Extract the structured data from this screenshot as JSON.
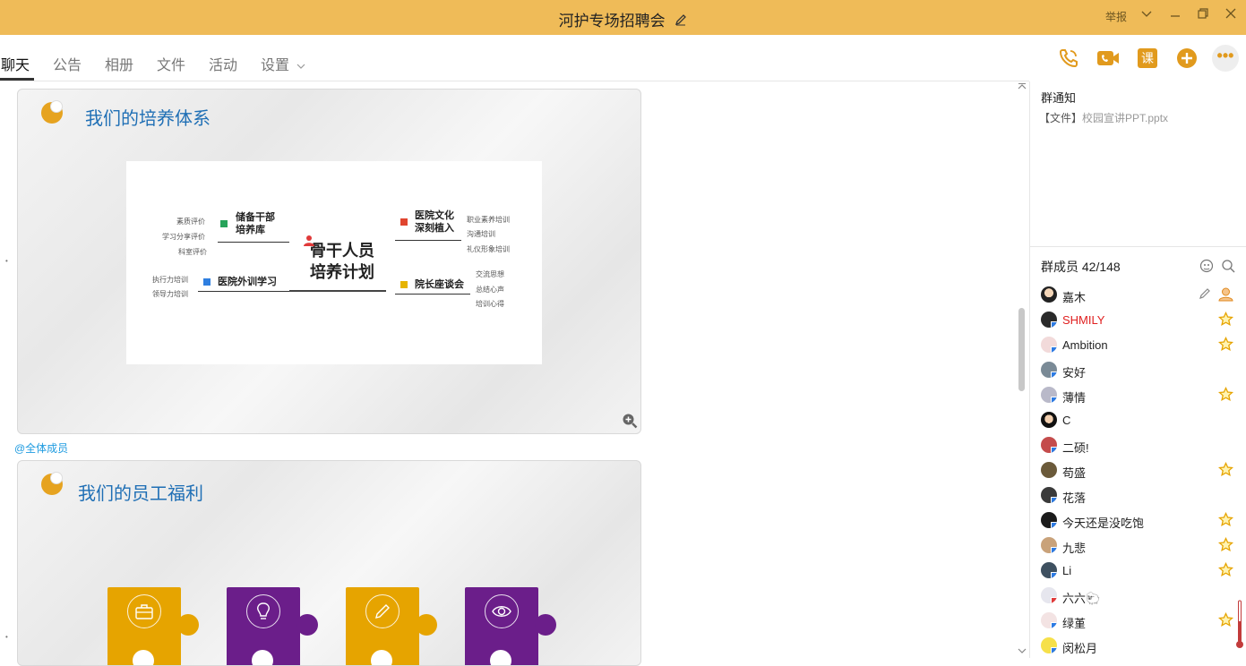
{
  "window": {
    "title": "河护专场招聘会",
    "report_label": "举报",
    "accent_color": "#efbb58"
  },
  "tabs": [
    {
      "label": "聊天",
      "active": true
    },
    {
      "label": "公告"
    },
    {
      "label": "相册"
    },
    {
      "label": "文件"
    },
    {
      "label": "活动"
    },
    {
      "label": "设置"
    }
  ],
  "toolbar": {
    "icons": [
      "phone-icon",
      "video-call-icon",
      "course-icon",
      "add-icon",
      "more-icon"
    ],
    "course_label": "课",
    "more_label": "•••"
  },
  "chat": {
    "slide1": {
      "title": "我们的培养体系",
      "mindmap": {
        "center": "骨干人员\n培养计划",
        "branches": [
          {
            "label": "储备干部\n培养库",
            "leaves": [
              "素质评价",
              "学习分享评价",
              "科室评价"
            ]
          },
          {
            "label": "医院外训学习",
            "leaves": [
              "执行力培训",
              "领导力培训"
            ]
          },
          {
            "label": "医院文化\n深刻植入",
            "leaves": [
              "职业素养培训",
              "沟通培训",
              "礼仪形象培训"
            ]
          },
          {
            "label": "院长座谈会",
            "leaves": [
              "交流思想",
              "总结心声",
              "培训心得"
            ]
          }
        ]
      }
    },
    "mention": "@全体成员",
    "slide2": {
      "title": "我们的员工福利",
      "puzzle_colors": [
        "#e6a400",
        "#6b1e8a",
        "#e6a400",
        "#6b1e8a"
      ],
      "puzzle_icons": [
        "briefcase-icon",
        "lightbulb-icon",
        "pencil-icon",
        "eye-icon"
      ]
    }
  },
  "notice": {
    "title": "群通知",
    "prefix": "【文件】",
    "file": "校园宣讲PPT.pptx"
  },
  "members": {
    "title": "群成员 42/148",
    "list": [
      {
        "name": "嘉木",
        "star": false,
        "owner": true
      },
      {
        "name": "SHMILY",
        "star": true,
        "red": true
      },
      {
        "name": "Ambition",
        "star": true
      },
      {
        "name": "安好",
        "star": false
      },
      {
        "name": "薄情",
        "star": true
      },
      {
        "name": "C",
        "star": false
      },
      {
        "name": "二硕!",
        "star": false
      },
      {
        "name": "苟盛",
        "star": true
      },
      {
        "name": "花落",
        "star": false
      },
      {
        "name": "今天还是没吃饱",
        "star": true
      },
      {
        "name": "九悲",
        "star": true
      },
      {
        "name": "Li",
        "star": true
      },
      {
        "name": "六六🐑",
        "star": false
      },
      {
        "name": "绿堇",
        "star": true
      },
      {
        "name": "闵松月",
        "star": false
      }
    ]
  }
}
